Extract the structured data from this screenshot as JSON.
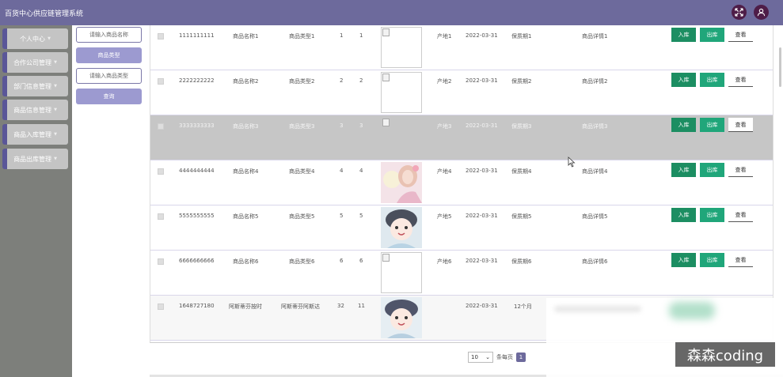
{
  "header": {
    "title": "百货中心供应链管理系统"
  },
  "sidebar": {
    "items": [
      {
        "label": "个人中心"
      },
      {
        "label": "合作公司管理"
      },
      {
        "label": "部门信息管理"
      },
      {
        "label": "商品信息管理"
      },
      {
        "label": "商品入库管理"
      },
      {
        "label": "商品出库管理"
      }
    ]
  },
  "filters": {
    "name_placeholder": "请输入商品名称",
    "type_button": "商品类型",
    "type_placeholder": "请输入商品类型",
    "search_button": "查询"
  },
  "table": {
    "actions": {
      "in": "入库",
      "out": "出库",
      "view": "查看"
    },
    "rows": [
      {
        "code": "1111111111",
        "name": "商品名称1",
        "type": "商品类型1",
        "q1": "1",
        "q2": "1",
        "image": "broken",
        "origin": "产地1",
        "date": "2022-03-31",
        "shelf": "保质期1",
        "detail": "商品详情1"
      },
      {
        "code": "2222222222",
        "name": "商品名称2",
        "type": "商品类型2",
        "q1": "2",
        "q2": "2",
        "image": "broken",
        "origin": "产地2",
        "date": "2022-03-31",
        "shelf": "保质期2",
        "detail": "商品详情2"
      },
      {
        "code": "3333333333",
        "name": "商品名称3",
        "type": "商品类型3",
        "q1": "3",
        "q2": "3",
        "image": "broken",
        "origin": "产地3",
        "date": "2022-03-31",
        "shelf": "保质期3",
        "detail": "商品详情3"
      },
      {
        "code": "4444444444",
        "name": "商品名称4",
        "type": "商品类型4",
        "q1": "4",
        "q2": "4",
        "image": "photo-girl-balloon",
        "origin": "产地4",
        "date": "2022-03-31",
        "shelf": "保质期4",
        "detail": "商品详情4"
      },
      {
        "code": "5555555555",
        "name": "商品名称5",
        "type": "商品类型5",
        "q1": "5",
        "q2": "5",
        "image": "photo-anime-girl",
        "origin": "产地5",
        "date": "2022-03-31",
        "shelf": "保质期5",
        "detail": "商品详情5"
      },
      {
        "code": "6666666666",
        "name": "商品名称6",
        "type": "商品类型6",
        "q1": "6",
        "q2": "6",
        "image": "broken",
        "origin": "产地6",
        "date": "2022-03-31",
        "shelf": "保质期6",
        "detail": "商品详情6"
      },
      {
        "code": "1648727180",
        "name": "阿斯蒂芬按时",
        "type": "阿斯蒂芬阿斯达",
        "q1": "32",
        "q2": "11",
        "image": "photo-anime-girl",
        "origin": "",
        "date": "2022-03-31",
        "shelf": "12个月",
        "detail": ""
      }
    ]
  },
  "pagination": {
    "page_size": "10",
    "per_page_label": "条每页",
    "current_page": "1"
  },
  "watermark": "森森coding",
  "colors": {
    "header": "#6d6a9c",
    "accent_dark": "#4e1d48",
    "button_green": "#1c8e62",
    "sidebar_bg": "#7d7f7b"
  }
}
